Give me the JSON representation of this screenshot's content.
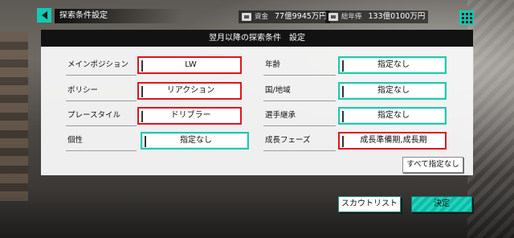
{
  "header": {
    "title": "探索条件設定",
    "funds_label": "資金",
    "funds_value": "77億9945万円",
    "total_salary_label": "総年俸",
    "total_salary_value": "133億0100万円"
  },
  "panel": {
    "title": "翌月以降の探索条件　設定"
  },
  "left_fields": [
    {
      "label": "メインポジション",
      "value": "LW",
      "highlight": "#e0141e"
    },
    {
      "label": "ポリシー",
      "value": "リアクション",
      "highlight": "#e0141e"
    },
    {
      "label": "プレースタイル",
      "value": "ドリブラー",
      "highlight": "#e0141e"
    },
    {
      "label": "個性",
      "value": "指定なし",
      "highlight": "#22c8b0"
    }
  ],
  "right_fields": [
    {
      "label": "年齢",
      "value": "指定なし",
      "highlight": "#22c8b0"
    },
    {
      "label": "国/地域",
      "value": "指定なし",
      "highlight": "#22c8b0"
    },
    {
      "label": "選手継承",
      "value": "指定なし",
      "highlight": "#22c8b0"
    },
    {
      "label": "成長フェーズ",
      "value": "成長準備期,成長期",
      "highlight": "#e0141e"
    }
  ],
  "buttons": {
    "clear_all": "すべて指定なし",
    "scout_list": "スカウトリスト",
    "confirm": "決定"
  },
  "icons": {
    "back": "back-arrow-icon",
    "menu": "grid-menu-icon",
    "money": "money-icon"
  }
}
